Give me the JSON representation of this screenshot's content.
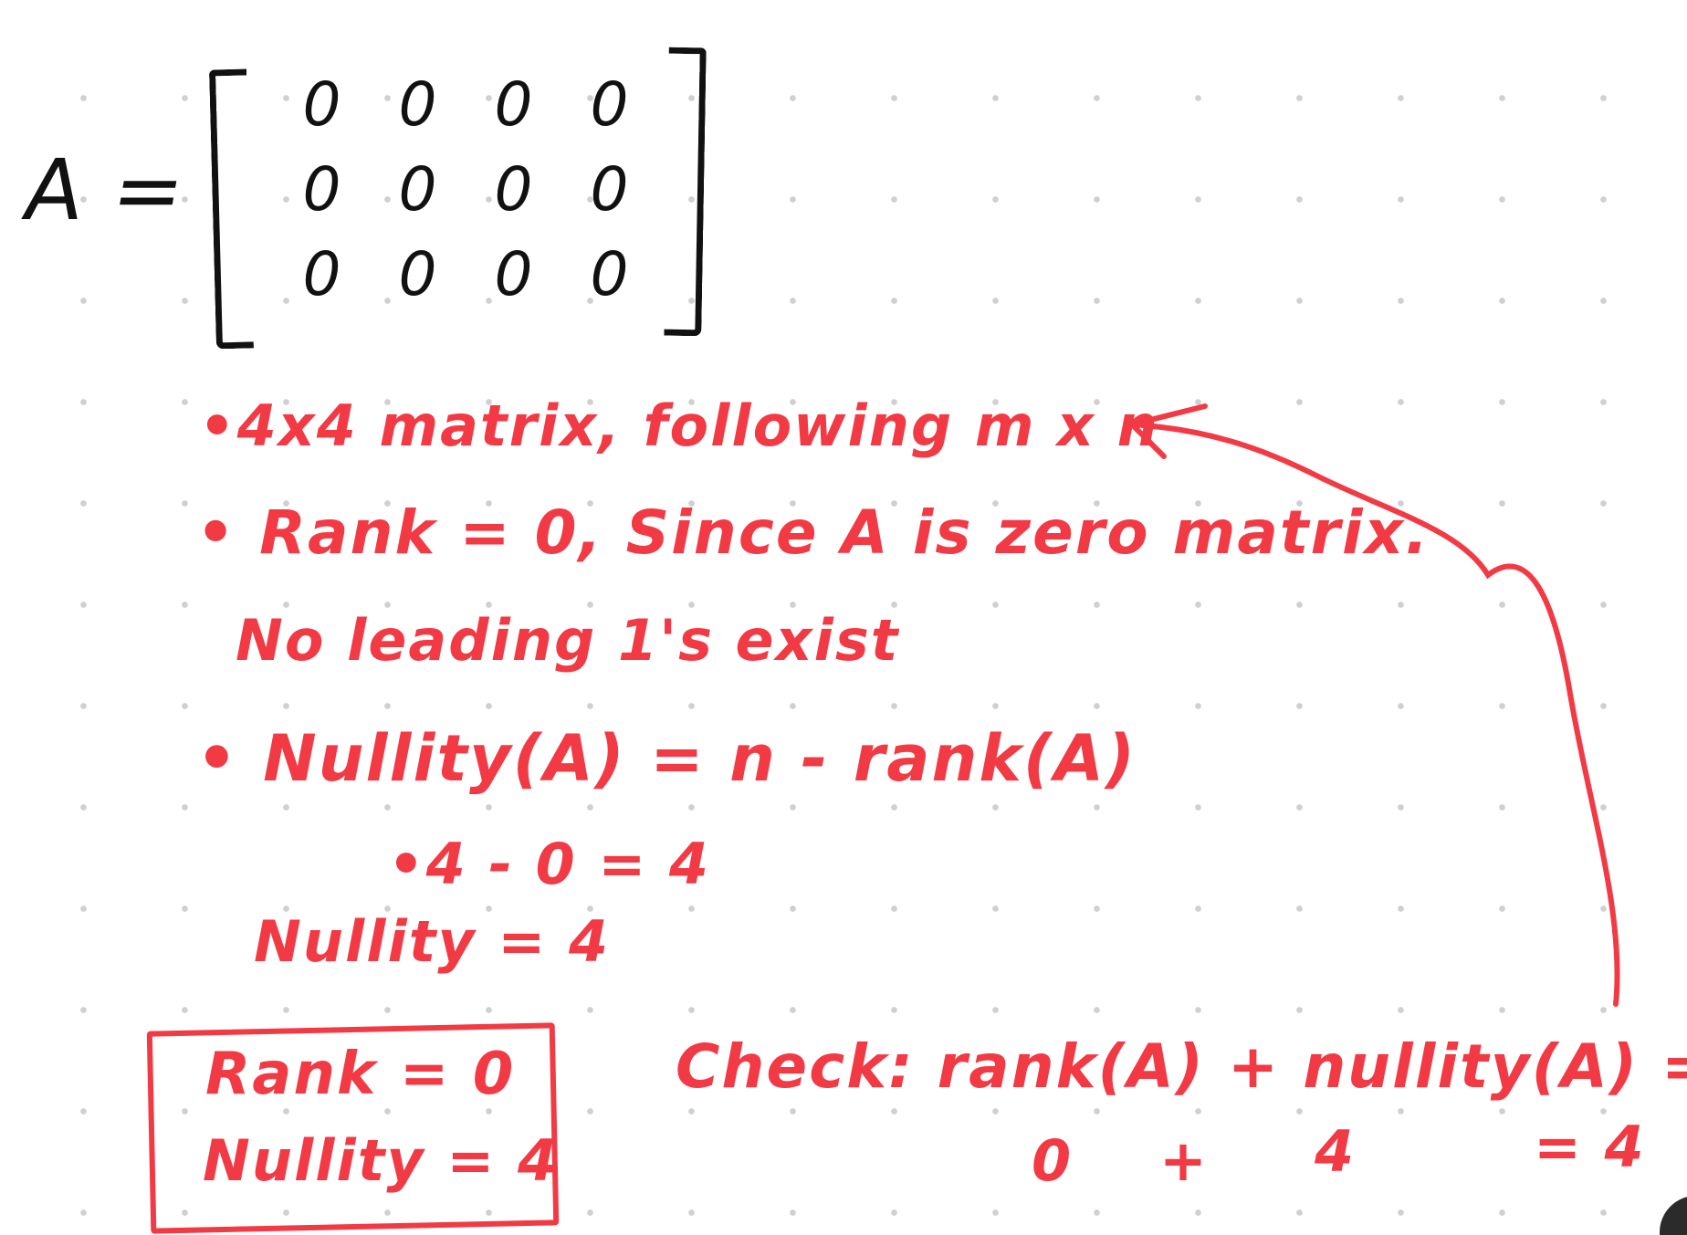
{
  "matrix": {
    "label": "A =",
    "rows": [
      [
        "0",
        "0",
        "0",
        "0"
      ],
      [
        "0",
        "0",
        "0",
        "0"
      ],
      [
        "0",
        "0",
        "0",
        "0"
      ]
    ]
  },
  "notes": {
    "line1": "•4x4 matrix, following m x n",
    "line2": "• Rank = 0, Since A is zero matrix.",
    "line3": "No leading 1's exist",
    "line4": "• Nullity(A) = n - rank(A)",
    "line5": "•4 - 0 = 4",
    "line6": "Nullity = 4"
  },
  "result_box": {
    "rank": "Rank = 0",
    "nullity": "Nullity = 4"
  },
  "check": {
    "equation": "Check: rank(A) + nullity(A) = n",
    "values": {
      "rank": "0",
      "plus": "+",
      "nullity": "4",
      "result": "= 4"
    }
  },
  "colors": {
    "ink_black": "#111111",
    "ink_red": "#f23a45",
    "dot_grid": "#cfcfd4"
  }
}
